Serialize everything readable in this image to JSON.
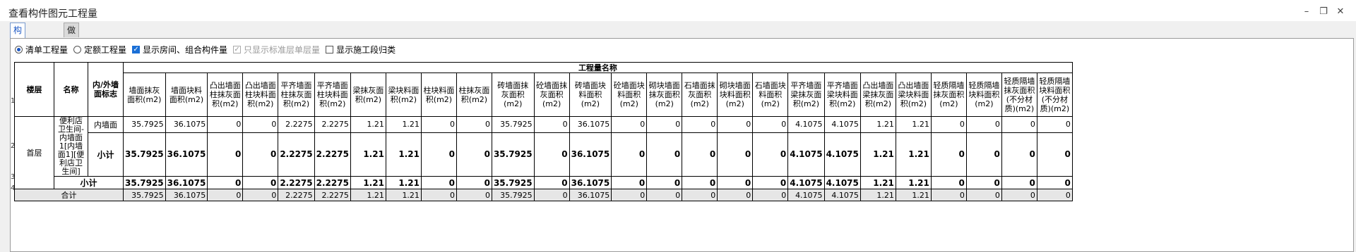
{
  "window": {
    "title": "查看构件图元工程量"
  },
  "tabs": [
    "构件工程量",
    "做法工程量"
  ],
  "options": [
    {
      "type": "radio",
      "label": "清单工程量",
      "checked": true
    },
    {
      "type": "radio",
      "label": "定额工程量",
      "checked": false
    },
    {
      "type": "checkbox",
      "label": "显示房间、组合构件量",
      "checked": true
    },
    {
      "type": "checkbox",
      "label": "只显示标准层单层量",
      "checked": true,
      "disabled": true
    },
    {
      "type": "checkbox",
      "label": "显示施工段归类",
      "checked": false
    }
  ],
  "table": {
    "group_header": "工程量名称",
    "fixed_headers": [
      "楼层",
      "名称",
      "内/外墙面标志"
    ],
    "columns": [
      "墙面抹灰面积(m2)",
      "墙面块料面积(m2)",
      "凸出墙面柱抹灰面积(m2)",
      "凸出墙面柱块料面积(m2)",
      "平齐墙面柱抹灰面积(m2)",
      "平齐墙面柱块料面积(m2)",
      "梁抹灰面积(m2)",
      "梁块料面积(m2)",
      "柱块料面积(m2)",
      "柱抹灰面积(m2)",
      "砖墙面抹灰面积(m2)",
      "砼墙面抹灰面积(m2)",
      "砖墙面块料面积(m2)",
      "砼墙面块料面积(m2)",
      "砌块墙面抹灰面积(m2)",
      "石墙面抹灰面积(m2)",
      "砌块墙面块料面积(m2)",
      "石墙面块料面积(m2)",
      "平齐墙面梁抹灰面积(m2)",
      "平齐墙面梁块料面积(m2)",
      "凸出墙面梁抹灰面积(m2)",
      "凸出墙面梁块料面积(m2)",
      "轻质隔墙抹灰面积(m2)",
      "轻质隔墙块料面积(m2)",
      "轻质隔墙抹灰面积(不分材质)(m2)",
      "轻质隔墙块料面积(不分材质)(m2)"
    ],
    "floor": "首层",
    "name": "便利店卫生间-内墙面1[内墙面1][便利店卫生间]",
    "row_numbers": [
      "1",
      "2",
      "3",
      "4"
    ],
    "rows": [
      {
        "label": "内墙面",
        "values": [
          "35.7925",
          "36.1075",
          "0",
          "0",
          "2.2275",
          "2.2275",
          "1.21",
          "1.21",
          "0",
          "0",
          "35.7925",
          "0",
          "36.1075",
          "0",
          "0",
          "0",
          "0",
          "0",
          "4.1075",
          "4.1075",
          "1.21",
          "1.21",
          "0",
          "0",
          "0",
          "0"
        ]
      },
      {
        "label": "小计",
        "values": [
          "35.7925",
          "36.1075",
          "0",
          "0",
          "2.2275",
          "2.2275",
          "1.21",
          "1.21",
          "0",
          "0",
          "35.7925",
          "0",
          "36.1075",
          "0",
          "0",
          "0",
          "0",
          "0",
          "4.1075",
          "4.1075",
          "1.21",
          "1.21",
          "0",
          "0",
          "0",
          "0"
        ]
      },
      {
        "label": "小计",
        "values": [
          "35.7925",
          "36.1075",
          "0",
          "0",
          "2.2275",
          "2.2275",
          "1.21",
          "1.21",
          "0",
          "0",
          "35.7925",
          "0",
          "36.1075",
          "0",
          "0",
          "0",
          "0",
          "0",
          "4.1075",
          "4.1075",
          "1.21",
          "1.21",
          "0",
          "0",
          "0",
          "0"
        ]
      },
      {
        "label": "合计",
        "values": [
          "35.7925",
          "36.1075",
          "0",
          "0",
          "2.2275",
          "2.2275",
          "1.21",
          "1.21",
          "0",
          "0",
          "35.7925",
          "0",
          "36.1075",
          "0",
          "0",
          "0",
          "0",
          "0",
          "4.1075",
          "4.1075",
          "1.21",
          "1.21",
          "0",
          "0",
          "0",
          "0"
        ]
      }
    ]
  }
}
